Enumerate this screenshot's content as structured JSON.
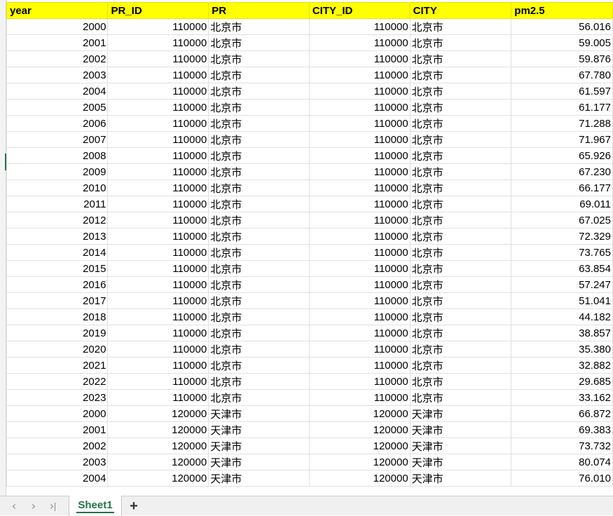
{
  "columns": [
    "year",
    "PR_ID",
    "PR",
    "CITY_ID",
    "CITY",
    "pm2.5"
  ],
  "rows": [
    [
      "2000",
      "110000",
      "北京市",
      "110000",
      "北京市",
      "56.016"
    ],
    [
      "2001",
      "110000",
      "北京市",
      "110000",
      "北京市",
      "59.005"
    ],
    [
      "2002",
      "110000",
      "北京市",
      "110000",
      "北京市",
      "59.876"
    ],
    [
      "2003",
      "110000",
      "北京市",
      "110000",
      "北京市",
      "67.780"
    ],
    [
      "2004",
      "110000",
      "北京市",
      "110000",
      "北京市",
      "61.597"
    ],
    [
      "2005",
      "110000",
      "北京市",
      "110000",
      "北京市",
      "61.177"
    ],
    [
      "2006",
      "110000",
      "北京市",
      "110000",
      "北京市",
      "71.288"
    ],
    [
      "2007",
      "110000",
      "北京市",
      "110000",
      "北京市",
      "71.967"
    ],
    [
      "2008",
      "110000",
      "北京市",
      "110000",
      "北京市",
      "65.926"
    ],
    [
      "2009",
      "110000",
      "北京市",
      "110000",
      "北京市",
      "67.230"
    ],
    [
      "2010",
      "110000",
      "北京市",
      "110000",
      "北京市",
      "66.177"
    ],
    [
      "2011",
      "110000",
      "北京市",
      "110000",
      "北京市",
      "69.011"
    ],
    [
      "2012",
      "110000",
      "北京市",
      "110000",
      "北京市",
      "67.025"
    ],
    [
      "2013",
      "110000",
      "北京市",
      "110000",
      "北京市",
      "72.329"
    ],
    [
      "2014",
      "110000",
      "北京市",
      "110000",
      "北京市",
      "73.765"
    ],
    [
      "2015",
      "110000",
      "北京市",
      "110000",
      "北京市",
      "63.854"
    ],
    [
      "2016",
      "110000",
      "北京市",
      "110000",
      "北京市",
      "57.247"
    ],
    [
      "2017",
      "110000",
      "北京市",
      "110000",
      "北京市",
      "51.041"
    ],
    [
      "2018",
      "110000",
      "北京市",
      "110000",
      "北京市",
      "44.182"
    ],
    [
      "2019",
      "110000",
      "北京市",
      "110000",
      "北京市",
      "38.857"
    ],
    [
      "2020",
      "110000",
      "北京市",
      "110000",
      "北京市",
      "35.380"
    ],
    [
      "2021",
      "110000",
      "北京市",
      "110000",
      "北京市",
      "32.882"
    ],
    [
      "2022",
      "110000",
      "北京市",
      "110000",
      "北京市",
      "29.685"
    ],
    [
      "2023",
      "110000",
      "北京市",
      "110000",
      "北京市",
      "33.162"
    ],
    [
      "2000",
      "120000",
      "天津市",
      "120000",
      "天津市",
      "66.872"
    ],
    [
      "2001",
      "120000",
      "天津市",
      "120000",
      "天津市",
      "69.383"
    ],
    [
      "2002",
      "120000",
      "天津市",
      "120000",
      "天津市",
      "73.732"
    ],
    [
      "2003",
      "120000",
      "天津市",
      "120000",
      "天津市",
      "80.074"
    ],
    [
      "2004",
      "120000",
      "天津市",
      "120000",
      "天津市",
      "76.010"
    ]
  ],
  "column_types": [
    "num",
    "num",
    "txt",
    "num",
    "txt",
    "num"
  ],
  "header_color": "#ffff00",
  "sheet_tabs": [
    "Sheet1"
  ],
  "nav_icons": [
    "chevron-left-icon",
    "chevron-right-icon",
    "chevron-last-icon"
  ],
  "add_sheet_label": "+",
  "accent_color": "#217346"
}
